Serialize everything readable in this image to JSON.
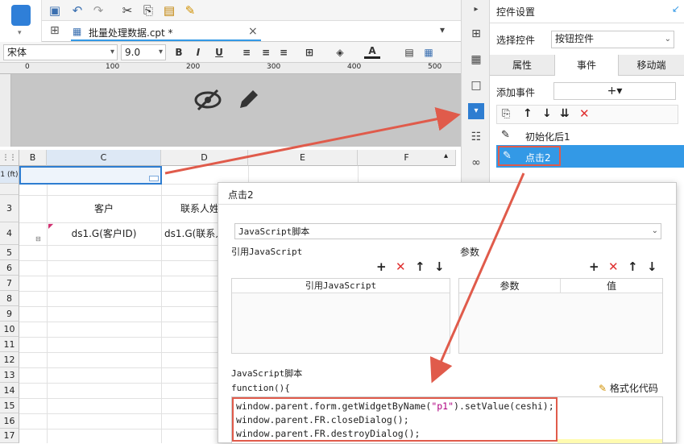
{
  "toolbar": {
    "file_tab": "批量处理数据.cpt *",
    "tab_close": "×"
  },
  "format": {
    "font": "宋体",
    "size": "9.0",
    "bold": "B",
    "italic": "I",
    "underline": "U"
  },
  "ruler": {
    "marks": [
      "0",
      "100",
      "200",
      "300",
      "400",
      "500"
    ]
  },
  "sheet": {
    "columns": [
      "B",
      "C",
      "D",
      "E",
      "F"
    ],
    "rows": [
      "1 (ft)",
      "3",
      "4",
      "5",
      "6",
      "7",
      "8",
      "9",
      "10",
      "11",
      "12",
      "13",
      "14",
      "15",
      "16",
      "17"
    ],
    "cells": {
      "c3": "客户",
      "d3": "联系人姓",
      "c4": "ds1.G(客户ID)",
      "d4": "ds1.G(联系人"
    }
  },
  "panel": {
    "title": "控件设置",
    "select_label": "选择控件",
    "select_value": "按钮控件",
    "tabs": [
      "属性",
      "事件",
      "移动端"
    ],
    "add_event_label": "添加事件",
    "add_btn": "+▾",
    "events": [
      "初始化后1",
      "点击2"
    ]
  },
  "dialog": {
    "title": "点击2",
    "type_select": "JavaScript脚本",
    "ref_js_label": "引用JavaScript",
    "params_label": "参数",
    "ref_js_header": "引用JavaScript",
    "param_col": "参数",
    "value_col": "值",
    "script_label": "JavaScript脚本",
    "function_line": "function(){",
    "format_btn": "格式化代码",
    "code": {
      "l1_a": "window.parent.form.getWidgetByName(",
      "l1_s": "\"p1\"",
      "l1_b": ").setValue(ceshi);",
      "l2": "window.parent.FR.closeDialog();",
      "l3": "window.parent.FR.destroyDialog();"
    }
  },
  "colors": {
    "accent": "#3399e6",
    "highlight_red": "#e05b4b",
    "dark_canvas": "#c6c6c6"
  }
}
